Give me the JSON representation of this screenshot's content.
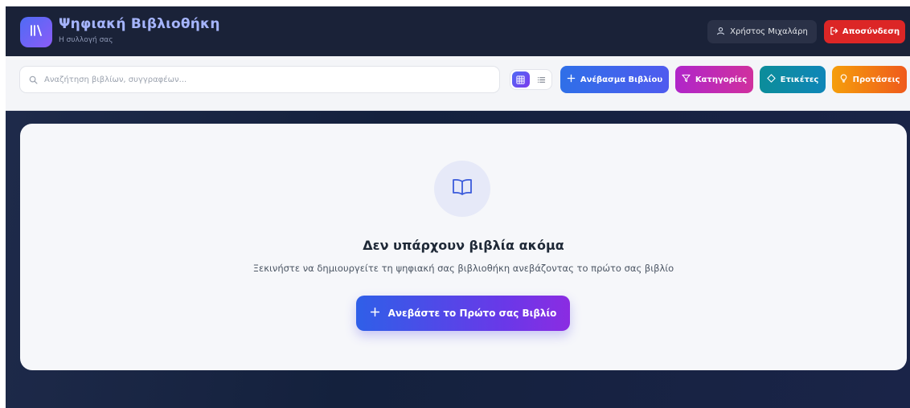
{
  "header": {
    "app_title": "Ψηφιακή Βιβλιοθήκη",
    "app_subtitle": "Η συλλογή σας",
    "logo_icon": "library-icon",
    "user_name": "Χρήστος Μιχαλάρη",
    "user_icon": "user-icon",
    "logout_label": "Αποσύνδεση",
    "logout_icon": "logout-icon"
  },
  "toolbar": {
    "search_placeholder": "Αναζήτηση βιβλίων, συγγραφέων...",
    "search_value": "",
    "search_icon": "search-icon",
    "view_mode": "grid",
    "view_options": [
      "grid",
      "list"
    ],
    "buttons": {
      "upload": {
        "label": "Ανέβασμα Βιβλίου",
        "icon": "plus-icon"
      },
      "categories": {
        "label": "Κατηγορίες",
        "icon": "filter-icon"
      },
      "tags": {
        "label": "Ετικέτες",
        "icon": "tag-icon"
      },
      "suggestions": {
        "label": "Προτάσεις",
        "icon": "lightbulb-icon"
      }
    }
  },
  "empty_state": {
    "icon": "book-open-icon",
    "title": "Δεν υπάρχουν βιβλία ακόμα",
    "description": "Ξεκινήστε να δημιουργείτε τη ψηφιακή σας βιβλιοθήκη ανεβάζοντας το πρώτο σας βιβλίο",
    "cta_label": "Ανεβάστε το Πρώτο σας Βιβλίο",
    "cta_icon": "plus-icon"
  },
  "colors": {
    "navbar_bg": "#1a2238",
    "title_accent": "#a5b4fc",
    "logout_red": "#dc2626",
    "upload_blue": "#2f6fe8",
    "categories_magenta": "#b026c9",
    "tags_teal": "#0c8d9a",
    "suggestions_orange": "#f59e0b",
    "cta_gradient_start": "#2f5fe8",
    "cta_gradient_end": "#8b2ce2"
  }
}
